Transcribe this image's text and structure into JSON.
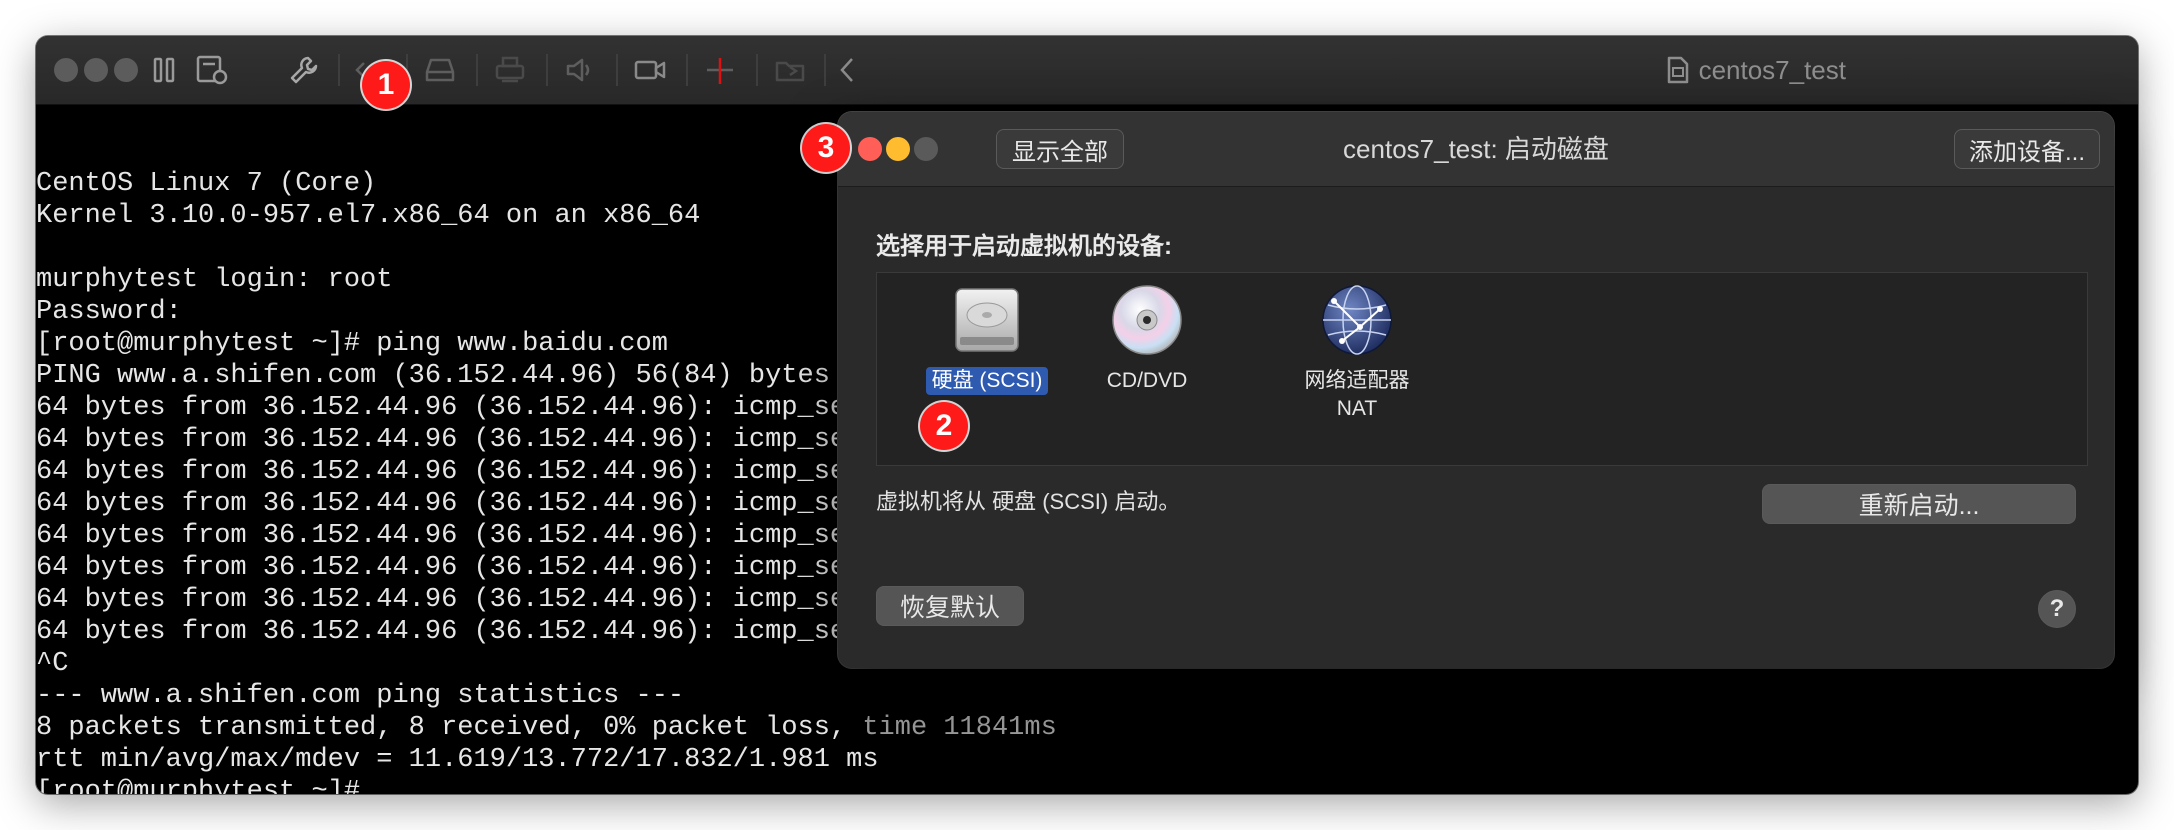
{
  "vm_window": {
    "title": "centos7_test",
    "toolbar_icons": [
      "pause-icon",
      "snapshot-icon",
      "wrench-icon",
      "code-icon",
      "disk-icon",
      "printer-icon",
      "sound-icon",
      "camera-icon",
      "usb-icon",
      "share-icon",
      "back-icon"
    ]
  },
  "terminal": {
    "lines": [
      {
        "text": "CentOS Linux 7 (Core)",
        "style": "normal"
      },
      {
        "text": "Kernel 3.10.0-957.el7.x86_64 on an x86_64",
        "style": "normal"
      },
      {
        "text": "",
        "style": "normal"
      },
      {
        "text": "murphytest login: root",
        "style": "normal"
      },
      {
        "text": "Password:",
        "style": "normal"
      },
      {
        "text": "[root@murphytest ~]# ping www.baidu.com",
        "style": "normal"
      },
      {
        "text": "PING www.a.shifen.com (36.152.44.96) 56(84) bytes",
        "style": "normal"
      },
      {
        "text": "64 bytes from 36.152.44.96 (36.152.44.96): icmp_se",
        "style": "normal"
      },
      {
        "text": "64 bytes from 36.152.44.96 (36.152.44.96): icmp_se",
        "style": "normal"
      },
      {
        "text": "64 bytes from 36.152.44.96 (36.152.44.96): icmp_se",
        "style": "normal"
      },
      {
        "text": "64 bytes from 36.152.44.96 (36.152.44.96): icmp_se",
        "style": "normal"
      },
      {
        "text": "64 bytes from 36.152.44.96 (36.152.44.96): icmp_se",
        "style": "normal"
      },
      {
        "text": "64 bytes from 36.152.44.96 (36.152.44.96): icmp_se",
        "style": "normal"
      },
      {
        "text": "64 bytes from 36.152.44.96 (36.152.44.96): icmp_se",
        "style": "normal"
      },
      {
        "text": "64 bytes from 36.152.44.96 (36.152.44.96): icmp_se",
        "style": "normal"
      },
      {
        "text": "^C",
        "style": "normal"
      },
      {
        "text": "--- www.a.shifen.com ping statistics ---",
        "style": "normal"
      },
      {
        "text": "8 packets transmitted, 8 received, 0% packet loss, ",
        "style": "normal",
        "tail": "time 11841ms"
      },
      {
        "text": "rtt min/avg/max/mdev = 11.619/13.772/17.832/1.981 ms",
        "style": "normal"
      },
      {
        "text": "[root@murphytest ~]#",
        "style": "normal"
      }
    ]
  },
  "dialog": {
    "title": "centos7_test: 启动磁盘",
    "show_all_button": "显示全部",
    "add_device_button": "添加设备...",
    "section_label": "选择用于启动虚拟机的设备:",
    "devices": [
      {
        "label": "硬盘 (SCSI)",
        "icon": "hard-disk-icon",
        "selected": true
      },
      {
        "label": "CD/DVD",
        "icon": "cd-dvd-icon",
        "selected": false
      },
      {
        "label": "网络适配器\nNAT",
        "icon": "network-globe-icon",
        "selected": false
      }
    ],
    "status_text": "虚拟机将从 硬盘 (SCSI) 启动。",
    "restart_button": "重新启动...",
    "restore_default_button": "恢复默认",
    "help_button": "?"
  },
  "annotations": [
    "1",
    "2",
    "3"
  ],
  "colors": {
    "close": "#ff5f57",
    "minimize": "#febc2e",
    "inactive": "#5c5c5c",
    "selection": "#2e5ab0",
    "badge": "#ff1a1a"
  }
}
